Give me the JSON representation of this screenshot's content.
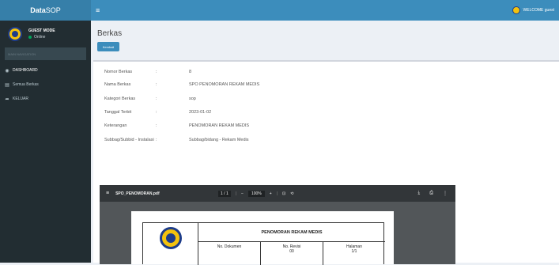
{
  "app": {
    "logo_bold": "Data",
    "logo_light": "SOP"
  },
  "user": {
    "name": "GUEST MODE",
    "status": "Online",
    "top_label": "WELCOME guest"
  },
  "sidebar": {
    "search_placeholder": "MAIN NAVIGATION",
    "items": [
      {
        "label": "DASHBOARD",
        "icon": "dashboard-icon"
      },
      {
        "label": "Semua Berkas",
        "icon": "file-icon"
      },
      {
        "label": "KELUAR",
        "icon": "sign-out-icon"
      }
    ]
  },
  "page": {
    "title": "Berkas",
    "back_label": "Kembali"
  },
  "details": [
    {
      "label": "Nomor Berkas",
      "value": "8"
    },
    {
      "label": "Nama Berkas",
      "value": "SPO PENOMORAN REKAM MEDIS"
    },
    {
      "label": "Kategori Berkas",
      "value": "sop"
    },
    {
      "label": "Tanggal Terbit",
      "value": "2023-01-02"
    },
    {
      "label": "Keterangan",
      "value": "PENOMORAN REKAM MEDIS"
    },
    {
      "label": "Subbag/Subbid - Instalasi",
      "value": "Subbag/bidang - Rekam Medis"
    }
  ],
  "pdf_viewer": {
    "filename": "SPO_PENOMORAN.pdf",
    "page_indicator": "1 / 1",
    "zoom": "100%",
    "doc_title": "PENOMORAN REKAM MEDIS",
    "col_dokumen": "No. Dokumen",
    "col_revisi": "No. Revisi",
    "revisi_value": "00",
    "col_halaman": "Halaman",
    "halaman_value": "1/1"
  },
  "colors": {
    "header_blue": "#3c8dbc",
    "sidebar_dark": "#222d32",
    "online_green": "#00a65a"
  }
}
